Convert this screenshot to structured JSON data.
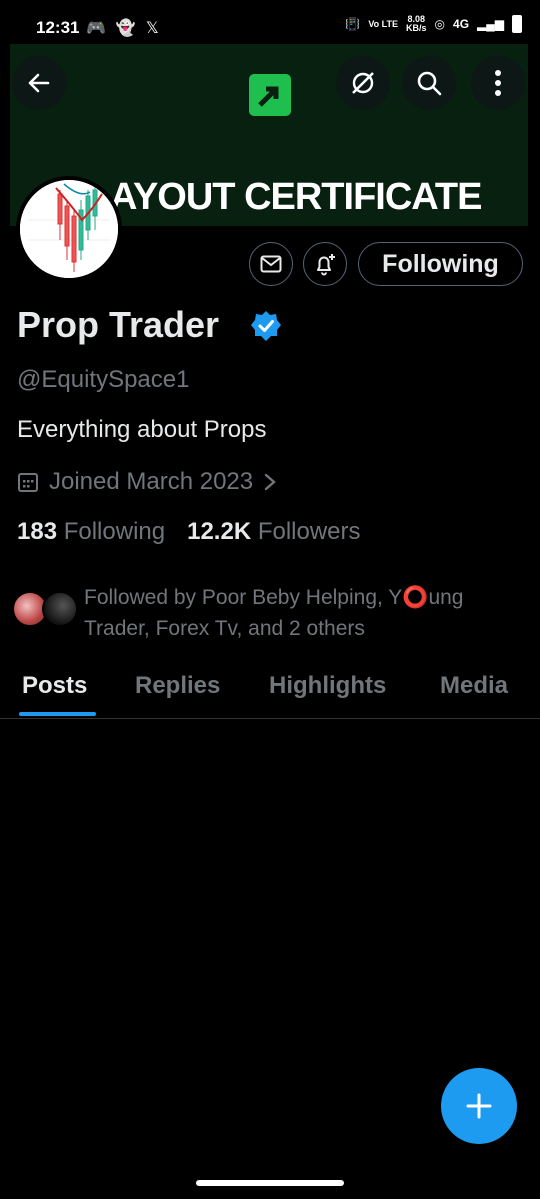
{
  "status_bar": {
    "time": "12:31",
    "network_speed_value": "8.08",
    "network_speed_unit": "KB/s",
    "network": "4G",
    "volte": "Vo LTE"
  },
  "banner": {
    "text": "AYOUT CERTIFICATE",
    "background": "#07200f",
    "logo_color": "#1fbf4f"
  },
  "profile": {
    "name": "Prop Trader",
    "handle": "@EquitySpace1",
    "bio": "Everything about Props",
    "joined": "Joined March 2023",
    "following_count": "183",
    "following_label": "Following",
    "followers_count": "12.2K",
    "followers_label": "Followers",
    "followed_by": "Followed by Poor Beby Helping, Y⭕ung Trader, Forex Tv, and 2 others"
  },
  "actions": {
    "follow_button_label": "Following"
  },
  "tabs": [
    {
      "label": "Posts",
      "active": true
    },
    {
      "label": "Replies",
      "active": false
    },
    {
      "label": "Highlights",
      "active": false
    },
    {
      "label": "Media",
      "active": false
    }
  ],
  "icons": {
    "back": "arrow-left-icon",
    "grok": "grok-icon",
    "search": "search-icon",
    "more": "more-vertical-icon",
    "message": "mail-icon",
    "notify": "bell-plus-icon",
    "verified": "verified-badge-icon",
    "calendar": "calendar-icon",
    "compose": "plus-icon"
  },
  "colors": {
    "accent": "#1d9bf0",
    "muted": "#71767b",
    "text": "#e7e9ea",
    "background": "#000000"
  }
}
